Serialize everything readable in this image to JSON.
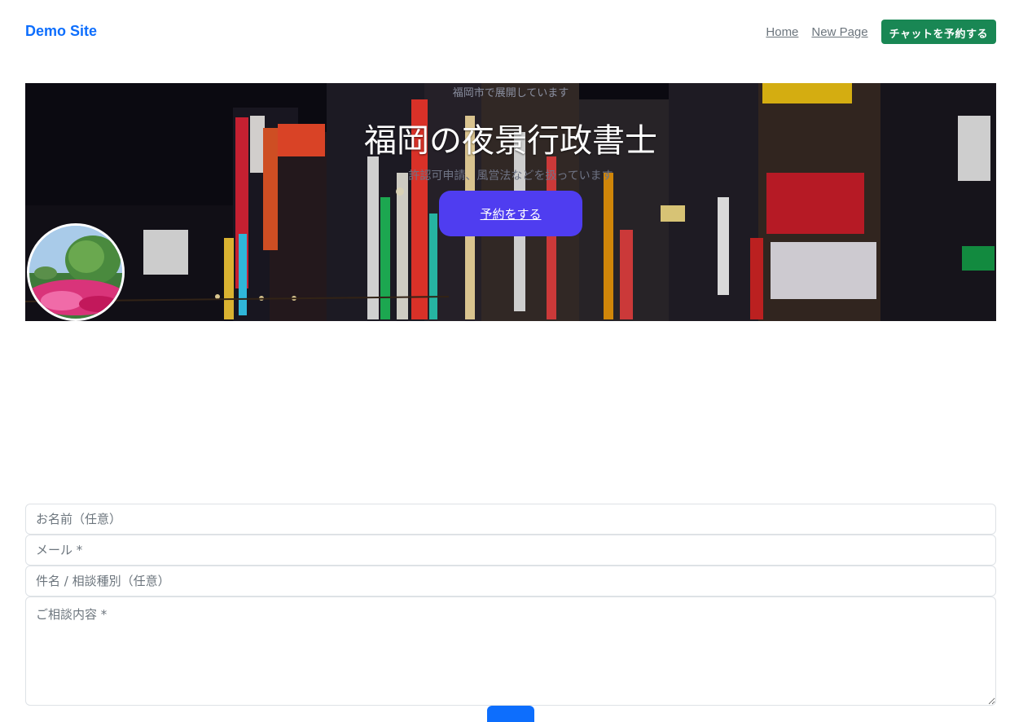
{
  "header": {
    "brand": "Demo Site",
    "nav": [
      {
        "label": "Home"
      },
      {
        "label": "New Page"
      }
    ],
    "cta_label": "チャットを予約する"
  },
  "hero": {
    "eyebrow": "福岡市で展開しています",
    "title": "福岡の夜景行政書士",
    "subtitle": "許認可申請、風営法などを扱っています",
    "button_label": "予約をする"
  },
  "form": {
    "name_placeholder": "お名前（任意）",
    "email_placeholder": "メール *",
    "subject_placeholder": "件名 / 相談種別（任意）",
    "message_placeholder": "ご相談内容 *"
  },
  "colors": {
    "brand": "#0d6efd",
    "cta": "#198754",
    "hero_button": "#4f3df0"
  }
}
